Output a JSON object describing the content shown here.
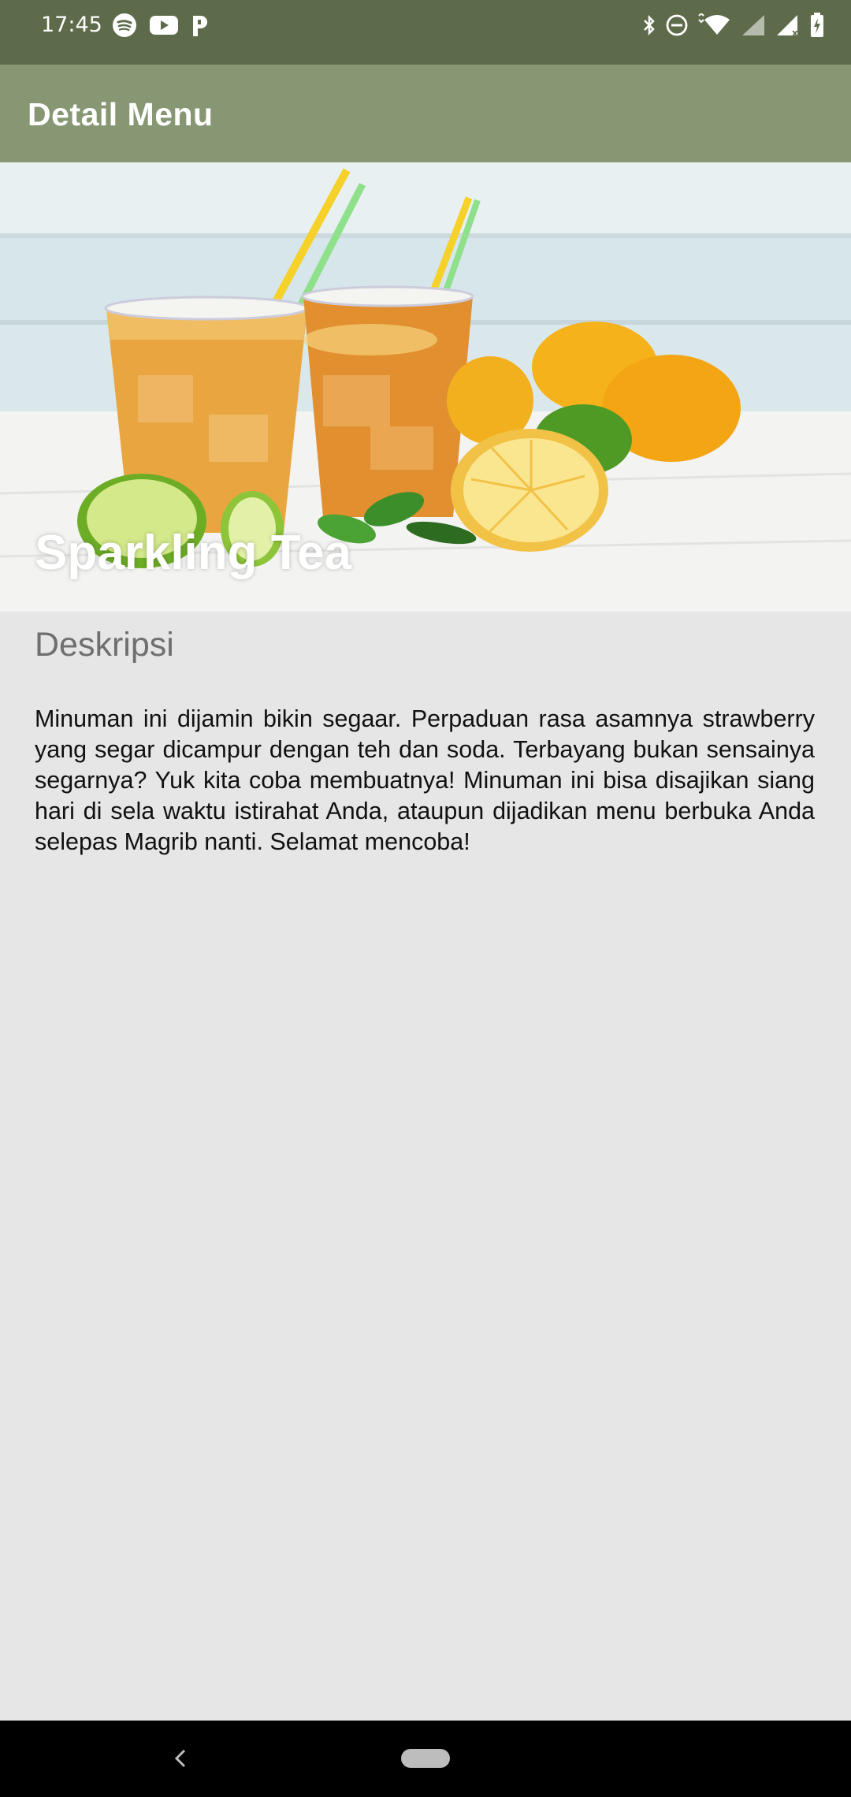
{
  "status_bar": {
    "time": "17:45",
    "left_icons": [
      "spotify-icon",
      "youtube-icon",
      "pandora-icon"
    ],
    "right_icons": [
      "bluetooth-icon",
      "do-not-disturb-icon",
      "wifi-icon",
      "cell-signal-icon",
      "cell-signal-no-data-icon",
      "battery-charging-icon"
    ]
  },
  "app_bar": {
    "title": "Detail Menu",
    "background_color": "#879773"
  },
  "hero": {
    "image_icon": "iced-tea-photo",
    "title": "Sparkling Tea"
  },
  "content": {
    "section_label": "Deskripsi",
    "description": "Minuman ini dijamin bikin segaar. Perpaduan rasa asamnya strawberry yang segar dicampur dengan teh dan soda. Terbayang bukan sensainya segarnya? Yuk kita coba membuatnya! Minuman ini bisa disajikan siang hari di sela waktu istirahat Anda, ataupun dijadikan menu berbuka Anda selepas Magrib nanti. Selamat mencoba!"
  },
  "nav_bar": {
    "back_icon": "back-chevron-icon",
    "home_icon": "home-pill-icon"
  }
}
